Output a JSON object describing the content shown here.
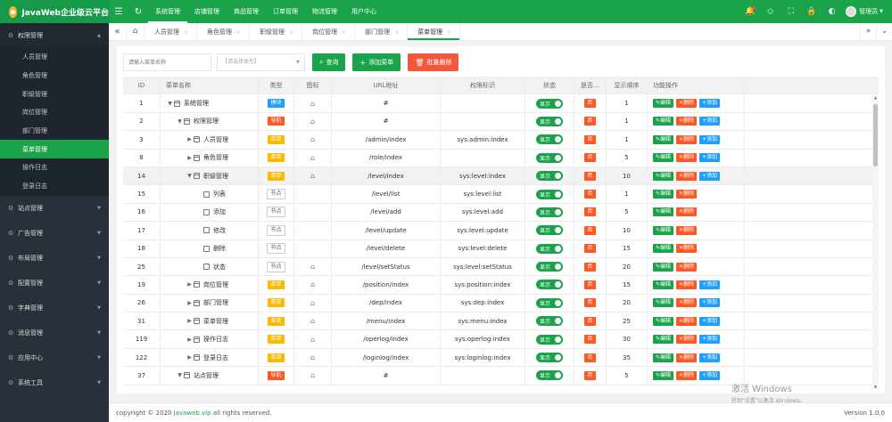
{
  "app": {
    "title": "JavaWeb企业级云平台"
  },
  "topnav": {
    "items": [
      "系统管理",
      "店铺管理",
      "商品管理",
      "订单管理",
      "物流管理",
      "用户中心"
    ],
    "active": 0
  },
  "user": {
    "name": "管理员"
  },
  "sidebar": {
    "open_group": {
      "label": "权限管理",
      "icon": "gear-icon"
    },
    "sub_items": [
      "人员管理",
      "角色管理",
      "职级管理",
      "岗位管理",
      "部门管理",
      "菜单管理",
      "操作日志",
      "登录日志"
    ],
    "active_sub": 5,
    "groups": [
      "站点管理",
      "广告管理",
      "布局管理",
      "配置管理",
      "字典管理",
      "消息管理",
      "应用中心",
      "系统工具"
    ]
  },
  "tabs": {
    "items": [
      "人员管理",
      "角色管理",
      "职级管理",
      "岗位管理",
      "部门管理",
      "菜单管理"
    ],
    "active": 5
  },
  "toolbar": {
    "search_placeholder": "请输入菜单名称",
    "select_placeholder": "【请选择类型】",
    "query_label": "查询",
    "add_label": "添加菜单",
    "batch_delete_label": "批量删除"
  },
  "table": {
    "headers": {
      "id": "ID",
      "name": "菜单名称",
      "type": "类型",
      "icon": "图标",
      "url": "URL地址",
      "perm": "权限标识",
      "status": "状态",
      "open": "是否…",
      "sort": "显示顺序",
      "ops": "功能操作"
    },
    "labels": {
      "status_on": "显示",
      "open_no": "否",
      "edit": "编辑",
      "delete": "删除",
      "add": "添加"
    },
    "type_labels": {
      "module": "模块",
      "nav": "导航",
      "menu": "菜单",
      "node": "节点"
    },
    "rows": [
      {
        "id": "1",
        "level": 0,
        "caret": "down",
        "name": "系统管理",
        "type": "module",
        "icon": true,
        "url": "#",
        "perm": "",
        "sort": "1",
        "add": true
      },
      {
        "id": "2",
        "level": 1,
        "caret": "down",
        "name": "权限管理",
        "type": "nav",
        "icon": true,
        "url": "#",
        "perm": "",
        "sort": "1",
        "add": true
      },
      {
        "id": "3",
        "level": 2,
        "caret": "right",
        "name": "人员管理",
        "type": "menu",
        "icon": true,
        "url": "/admin/index",
        "perm": "sys:admin:index",
        "sort": "1",
        "add": true
      },
      {
        "id": "8",
        "level": 2,
        "caret": "right",
        "name": "角色管理",
        "type": "menu",
        "icon": true,
        "url": "/role/index",
        "perm": "",
        "sort": "5",
        "add": true
      },
      {
        "id": "14",
        "level": 2,
        "caret": "down",
        "name": "职级管理",
        "type": "menu",
        "icon": true,
        "url": "/level/index",
        "perm": "sys:level:index",
        "sort": "10",
        "add": true,
        "highlight": true
      },
      {
        "id": "15",
        "level": 3,
        "caret": "none",
        "name": "列表",
        "type": "node",
        "icon": false,
        "url": "/level/list",
        "perm": "sys:level:list",
        "sort": "1",
        "add": false
      },
      {
        "id": "16",
        "level": 3,
        "caret": "none",
        "name": "添加",
        "type": "node",
        "icon": false,
        "url": "/level/add",
        "perm": "sys:level:add",
        "sort": "5",
        "add": false
      },
      {
        "id": "17",
        "level": 3,
        "caret": "none",
        "name": "修改",
        "type": "node",
        "icon": false,
        "url": "/level/update",
        "perm": "sys:level:update",
        "sort": "10",
        "add": false
      },
      {
        "id": "18",
        "level": 3,
        "caret": "none",
        "name": "删除",
        "type": "node",
        "icon": false,
        "url": "/level/delete",
        "perm": "sys:level:delete",
        "sort": "15",
        "add": false
      },
      {
        "id": "25",
        "level": 3,
        "caret": "none",
        "name": "状态",
        "type": "node",
        "icon": true,
        "url": "/level/setStatus",
        "perm": "sys:level:setStatus",
        "sort": "20",
        "add": false
      },
      {
        "id": "19",
        "level": 2,
        "caret": "right",
        "name": "岗位管理",
        "type": "menu",
        "icon": true,
        "url": "/position/index",
        "perm": "sys:position:index",
        "sort": "15",
        "add": true
      },
      {
        "id": "26",
        "level": 2,
        "caret": "right",
        "name": "部门管理",
        "type": "menu",
        "icon": true,
        "url": "/dep/index",
        "perm": "sys:dep:index",
        "sort": "20",
        "add": true
      },
      {
        "id": "31",
        "level": 2,
        "caret": "right",
        "name": "菜单管理",
        "type": "menu",
        "icon": true,
        "url": "/menu/index",
        "perm": "sys:menu:index",
        "sort": "25",
        "add": true
      },
      {
        "id": "119",
        "level": 2,
        "caret": "right",
        "name": "操作日志",
        "type": "menu",
        "icon": true,
        "url": "/operlog/index",
        "perm": "sys:operlog:index",
        "sort": "30",
        "add": true
      },
      {
        "id": "122",
        "level": 2,
        "caret": "right",
        "name": "登录日志",
        "type": "menu",
        "icon": true,
        "url": "/loginlog/index",
        "perm": "sys:loginlog:index",
        "sort": "35",
        "add": true
      },
      {
        "id": "37",
        "level": 1,
        "caret": "down",
        "name": "站点管理",
        "type": "nav",
        "icon": true,
        "url": "#",
        "perm": "",
        "sort": "5",
        "add": true
      }
    ]
  },
  "footer": {
    "prefix": "copyright © 2020",
    "link": "javaweb.vip",
    "suffix": "all rights reserved.",
    "version": "Version 1.0.0"
  },
  "watermark": {
    "title": "激活 Windows",
    "sub": "转到\"设置\"以激活 Windows。"
  }
}
